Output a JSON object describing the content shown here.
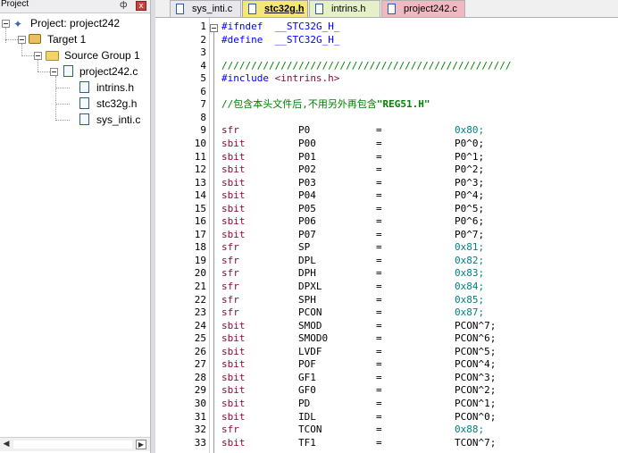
{
  "project_panel": {
    "title": "Project",
    "pin": "ф",
    "close": "x",
    "tree": {
      "project": "Project: project242",
      "target": "Target 1",
      "group": "Source Group 1",
      "file_main": "project242.c",
      "deps": [
        "intrins.h",
        "stc32g.h",
        "sys_inti.c"
      ]
    }
  },
  "tabs": [
    {
      "label": "sys_inti.c",
      "color": "#e8e8ec"
    },
    {
      "label": "stc32g.h",
      "color": "#f5e67a",
      "active": true
    },
    {
      "label": "intrins.h",
      "color": "#e6f0c8"
    },
    {
      "label": "project242.c",
      "color": "#f0b8c0"
    }
  ],
  "editor": {
    "pre_lines": [
      {
        "n": "1",
        "text": "#ifndef  __STC32G_H_",
        "cls": "c-pre"
      },
      {
        "n": "2",
        "text": "#define  __STC32G_H_",
        "cls": "c-pre"
      },
      {
        "n": "3",
        "text": "",
        "cls": "c-blk"
      },
      {
        "n": "4",
        "text": "/////////////////////////////////////////////////",
        "cls": "c-com"
      },
      {
        "n": "5",
        "text": "#include <intrins.h>",
        "cls": "c-pre"
      },
      {
        "n": "6",
        "text": "",
        "cls": "c-blk"
      },
      {
        "n": "7",
        "text": "//包含本头文件后,不用另外再包含\"REG51.H\"",
        "cls": "c-com"
      },
      {
        "n": "8",
        "text": "",
        "cls": "c-blk"
      }
    ],
    "decls": [
      {
        "n": "9",
        "kw": "sfr",
        "name": "P0",
        "op": "=",
        "val": "0x80;",
        "hex": true
      },
      {
        "n": "10",
        "kw": "sbit",
        "name": "P00",
        "op": "=",
        "val": "P0^0;",
        "hex": false
      },
      {
        "n": "11",
        "kw": "sbit",
        "name": "P01",
        "op": "=",
        "val": "P0^1;",
        "hex": false
      },
      {
        "n": "12",
        "kw": "sbit",
        "name": "P02",
        "op": "=",
        "val": "P0^2;",
        "hex": false
      },
      {
        "n": "13",
        "kw": "sbit",
        "name": "P03",
        "op": "=",
        "val": "P0^3;",
        "hex": false
      },
      {
        "n": "14",
        "kw": "sbit",
        "name": "P04",
        "op": "=",
        "val": "P0^4;",
        "hex": false
      },
      {
        "n": "15",
        "kw": "sbit",
        "name": "P05",
        "op": "=",
        "val": "P0^5;",
        "hex": false
      },
      {
        "n": "16",
        "kw": "sbit",
        "name": "P06",
        "op": "=",
        "val": "P0^6;",
        "hex": false
      },
      {
        "n": "17",
        "kw": "sbit",
        "name": "P07",
        "op": "=",
        "val": "P0^7;",
        "hex": false
      },
      {
        "n": "18",
        "kw": "sfr",
        "name": "SP",
        "op": "=",
        "val": "0x81;",
        "hex": true
      },
      {
        "n": "19",
        "kw": "sfr",
        "name": "DPL",
        "op": "=",
        "val": "0x82;",
        "hex": true
      },
      {
        "n": "20",
        "kw": "sfr",
        "name": "DPH",
        "op": "=",
        "val": "0x83;",
        "hex": true
      },
      {
        "n": "21",
        "kw": "sfr",
        "name": "DPXL",
        "op": "=",
        "val": "0x84;",
        "hex": true
      },
      {
        "n": "22",
        "kw": "sfr",
        "name": "SPH",
        "op": "=",
        "val": "0x85;",
        "hex": true
      },
      {
        "n": "23",
        "kw": "sfr",
        "name": "PCON",
        "op": "=",
        "val": "0x87;",
        "hex": true
      },
      {
        "n": "24",
        "kw": "sbit",
        "name": "SMOD",
        "op": "=",
        "val": "PCON^7;",
        "hex": false
      },
      {
        "n": "25",
        "kw": "sbit",
        "name": "SMOD0",
        "op": "=",
        "val": "PCON^6;",
        "hex": false
      },
      {
        "n": "26",
        "kw": "sbit",
        "name": "LVDF",
        "op": "=",
        "val": "PCON^5;",
        "hex": false
      },
      {
        "n": "27",
        "kw": "sbit",
        "name": "POF",
        "op": "=",
        "val": "PCON^4;",
        "hex": false
      },
      {
        "n": "28",
        "kw": "sbit",
        "name": "GF1",
        "op": "=",
        "val": "PCON^3;",
        "hex": false
      },
      {
        "n": "29",
        "kw": "sbit",
        "name": "GF0",
        "op": "=",
        "val": "PCON^2;",
        "hex": false
      },
      {
        "n": "30",
        "kw": "sbit",
        "name": "PD",
        "op": "=",
        "val": "PCON^1;",
        "hex": false
      },
      {
        "n": "31",
        "kw": "sbit",
        "name": "IDL",
        "op": "=",
        "val": "PCON^0;",
        "hex": false
      },
      {
        "n": "32",
        "kw": "sfr",
        "name": "TCON",
        "op": "=",
        "val": "0x88;",
        "hex": true
      },
      {
        "n": "33",
        "kw": "sbit",
        "name": "TF1",
        "op": "=",
        "val": "TCON^7;",
        "hex": false
      }
    ]
  },
  "colors": {
    "preprocessor": "#0000ff",
    "comment": "#008000",
    "keyword": "#8b0a3a",
    "hex_number": "#008080"
  }
}
